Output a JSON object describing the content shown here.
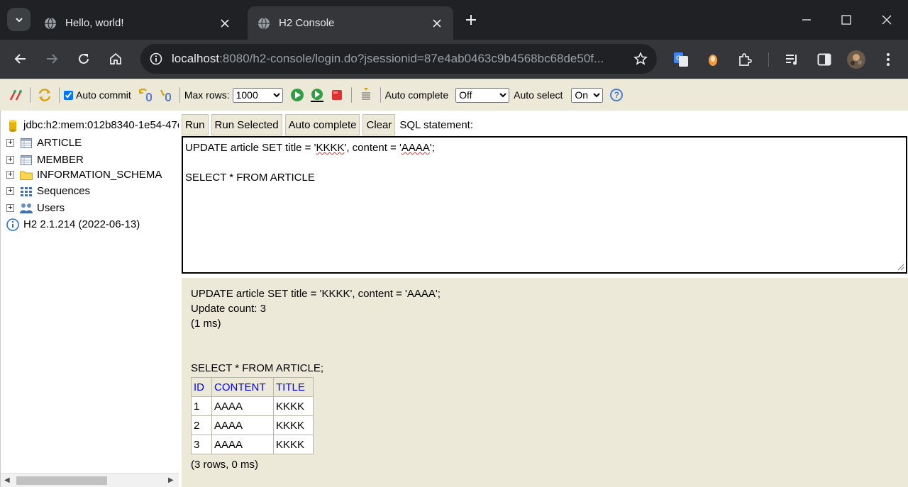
{
  "browser": {
    "tabs": [
      {
        "title": "Hello, world!",
        "active": false
      },
      {
        "title": "H2 Console",
        "active": true
      }
    ],
    "url_host": "localhost",
    "url_rest": ":8080/h2-console/login.do?jsessionid=87e4ab0463c9b4568bc68de50f..."
  },
  "h2toolbar": {
    "auto_commit_label": "Auto commit",
    "auto_commit_checked": true,
    "max_rows_label": "Max rows:",
    "max_rows_value": "1000",
    "auto_complete_label": "Auto complete",
    "auto_complete_value": "Off",
    "auto_select_label": "Auto select",
    "auto_select_value": "On",
    "help_glyph": "?"
  },
  "tree": {
    "connection": "jdbc:h2:mem:012b8340-1e54-47c",
    "items": [
      {
        "label": "ARTICLE",
        "icon": "table-icon"
      },
      {
        "label": "MEMBER",
        "icon": "table-icon"
      },
      {
        "label": "INFORMATION_SCHEMA",
        "icon": "folder-icon"
      },
      {
        "label": "Sequences",
        "icon": "sequences-icon"
      },
      {
        "label": "Users",
        "icon": "users-icon"
      }
    ],
    "version": "H2 2.1.214 (2022-06-13)"
  },
  "query": {
    "buttons": {
      "run": "Run",
      "run_selected": "Run Selected",
      "auto_complete": "Auto complete",
      "clear": "Clear"
    },
    "sql_label": "SQL statement:",
    "line1_a": "UPDATE article SET title = '",
    "line1_b": "KKKK",
    "line1_c": "', content = '",
    "line1_d": "AAAA",
    "line1_e": "';",
    "line3": "SELECT * FROM ARTICLE"
  },
  "result": {
    "update_stmt": "UPDATE article SET title = 'KKKK', content = 'AAAA';",
    "update_count": "Update count: 3",
    "update_time": "(1 ms)",
    "select_stmt": "SELECT * FROM ARTICLE;",
    "columns": [
      "ID",
      "CONTENT",
      "TITLE"
    ],
    "rows": [
      [
        "1",
        "AAAA",
        "KKKK"
      ],
      [
        "2",
        "AAAA",
        "KKKK"
      ],
      [
        "3",
        "AAAA",
        "KKKK"
      ]
    ],
    "summary": "(3 rows, 0 ms)"
  }
}
